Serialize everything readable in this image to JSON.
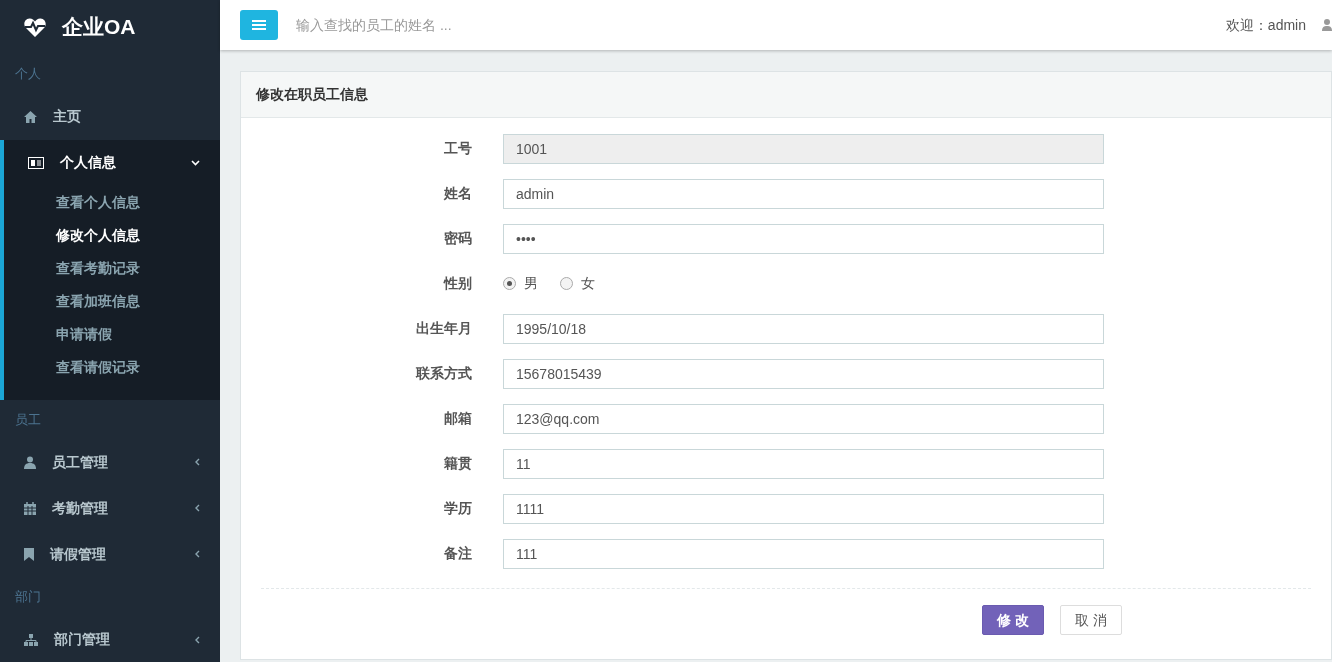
{
  "brand": "企业OA",
  "sidebar": [
    {
      "header": "个人",
      "items": [
        {
          "kind": "link",
          "label": "主页"
        },
        {
          "kind": "group",
          "label": "个人信息",
          "expanded": true,
          "children": [
            {
              "label": "查看个人信息",
              "selected": false
            },
            {
              "label": "修改个人信息",
              "selected": true
            },
            {
              "label": "查看考勤记录",
              "selected": false
            },
            {
              "label": "查看加班信息",
              "selected": false
            },
            {
              "label": "申请请假",
              "selected": false
            },
            {
              "label": "查看请假记录",
              "selected": false
            }
          ]
        }
      ]
    },
    {
      "header": "员工",
      "items": [
        {
          "kind": "group",
          "label": "员工管理",
          "expanded": false
        },
        {
          "kind": "group",
          "label": "考勤管理",
          "expanded": false
        },
        {
          "kind": "group",
          "label": "请假管理",
          "expanded": false
        }
      ]
    },
    {
      "header": "部门",
      "items": [
        {
          "kind": "group",
          "label": "部门管理",
          "expanded": false
        }
      ]
    }
  ],
  "topbar": {
    "search_placeholder": "输入查找的员工的姓名 ...",
    "welcome": "欢迎：admin"
  },
  "panel": {
    "title": "修改在职员工信息",
    "fields": [
      {
        "kind": "text",
        "label": "工号",
        "value": "1001",
        "disabled": true
      },
      {
        "kind": "text",
        "label": "姓名",
        "value": "admin",
        "disabled": false
      },
      {
        "kind": "password",
        "label": "密码",
        "value": "••••",
        "disabled": false
      },
      {
        "kind": "radio",
        "label": "性别",
        "options": [
          {
            "label": "男",
            "selected": true
          },
          {
            "label": "女",
            "selected": false
          }
        ]
      },
      {
        "kind": "text",
        "label": "出生年月",
        "value": "1995/10/18",
        "disabled": false
      },
      {
        "kind": "text",
        "label": "联系方式",
        "value": "15678015439",
        "disabled": false
      },
      {
        "kind": "text",
        "label": "邮箱",
        "value": "123@qq.com",
        "disabled": false
      },
      {
        "kind": "text",
        "label": "籍贯",
        "value": "11",
        "disabled": false
      },
      {
        "kind": "text",
        "label": "学历",
        "value": "1111",
        "disabled": false
      },
      {
        "kind": "text",
        "label": "备注",
        "value": "111",
        "disabled": false
      }
    ],
    "buttons": [
      {
        "kind": "primary",
        "label": "修 改"
      },
      {
        "kind": "default",
        "label": "取 消"
      }
    ]
  }
}
